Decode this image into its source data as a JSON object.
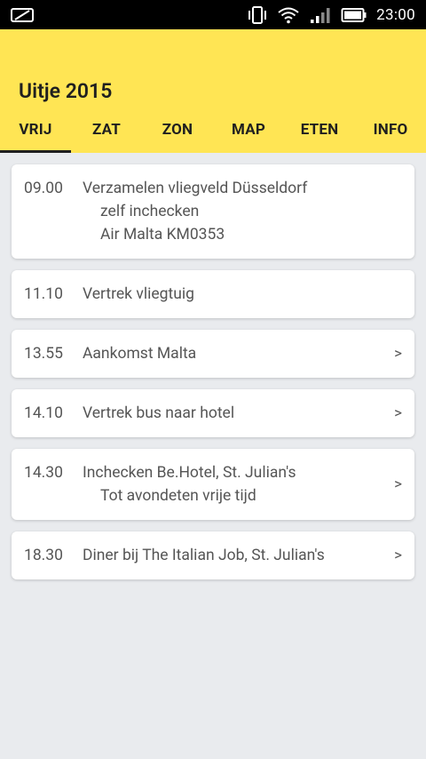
{
  "status": {
    "time": "23:00"
  },
  "app": {
    "title": "Uitje 2015"
  },
  "tabs": [
    {
      "label": "VRIJ",
      "active": true
    },
    {
      "label": "ZAT"
    },
    {
      "label": "ZON"
    },
    {
      "label": "MAP"
    },
    {
      "label": "ETEN"
    },
    {
      "label": "INFO"
    }
  ],
  "schedule": [
    {
      "time": "09.00",
      "lines": [
        "Verzamelen vliegveld Düsseldorf",
        "zelf inchecken",
        "Air Malta KM0353"
      ]
    },
    {
      "time": "11.10",
      "lines": [
        "Vertrek vliegtuig"
      ]
    },
    {
      "time": "13.55",
      "lines": [
        "Aankomst Malta"
      ],
      "chevron": ">"
    },
    {
      "time": "14.10",
      "lines": [
        "Vertrek bus naar hotel"
      ],
      "chevron": ">"
    },
    {
      "time": "14.30",
      "lines": [
        "Inchecken Be.Hotel, St. Julian's",
        "Tot avondeten vrije tijd"
      ],
      "chevron": ">"
    },
    {
      "time": "18.30",
      "lines": [
        "Diner bij The Italian Job, St. Julian's"
      ],
      "chevron": ">"
    }
  ]
}
